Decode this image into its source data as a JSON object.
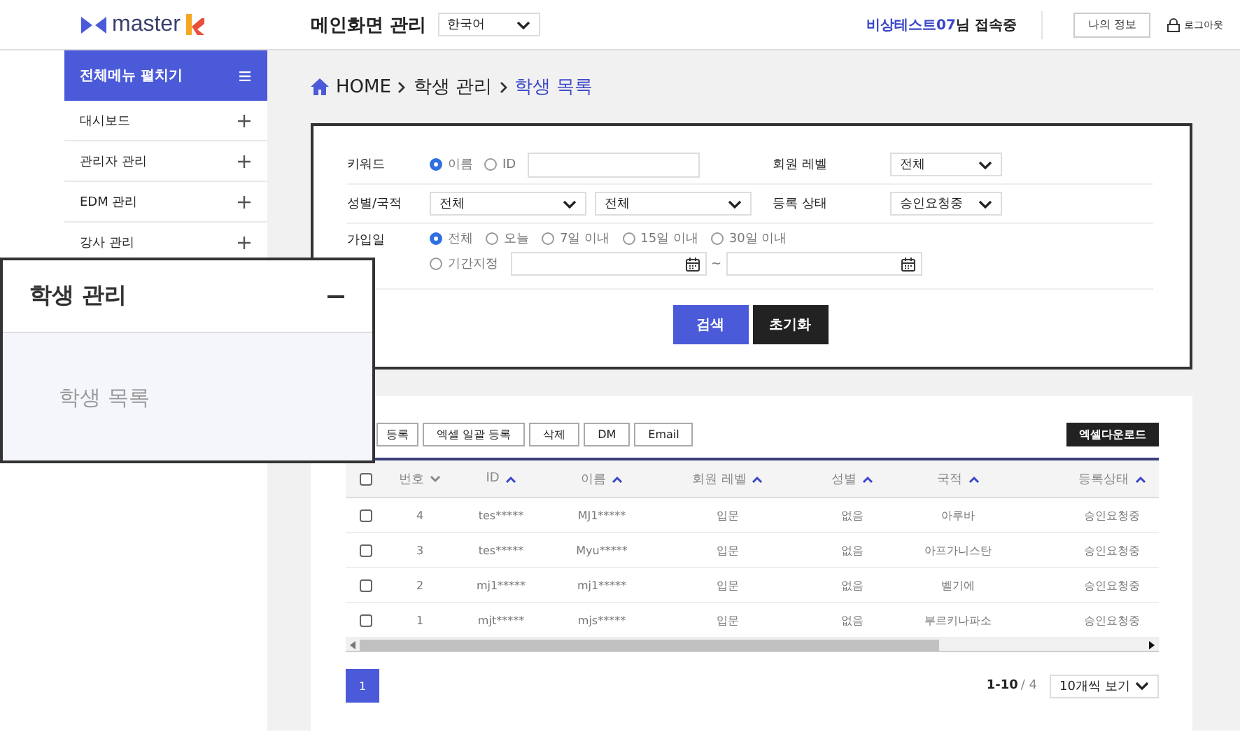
{
  "header": {
    "logo": "master",
    "title": "메인화면 관리",
    "language": "한국어",
    "user_name": "비상테스트07",
    "user_suffix": "님 접속중",
    "my_info_button": "나의 정보",
    "logout": "로그아웃"
  },
  "sidebar": {
    "toggle": "전체메뉴 펼치기",
    "items": [
      {
        "label": "대시보드",
        "expanded": false
      },
      {
        "label": "관리자 관리",
        "expanded": false
      },
      {
        "label": "EDM 관리",
        "expanded": false
      },
      {
        "label": "강사 관리",
        "expanded": false
      }
    ]
  },
  "zoom_callout": {
    "label": "학생 관리",
    "expanded": true,
    "children": [
      {
        "label": "학생 목록",
        "selected": false
      }
    ]
  },
  "breadcrumb": [
    "HOME",
    "학생 관리",
    "학생 목록"
  ],
  "search": {
    "rows": [
      {
        "kind": "keyword",
        "label": "키워드",
        "options": [
          {
            "label": "이름",
            "selected": true
          },
          {
            "label": "ID",
            "selected": false
          }
        ],
        "right_label": "회원 레벨",
        "right_select": "전체"
      },
      {
        "kind": "selects",
        "label": "성별/국적",
        "selects": [
          "전체",
          "전체"
        ],
        "right_label": "등록 상태",
        "right_select": "승인요청중"
      },
      {
        "kind": "dates",
        "label": "가입일",
        "options": [
          {
            "label": "전체",
            "selected": true
          },
          {
            "label": "오늘",
            "selected": false
          },
          {
            "label": "7일 이내",
            "selected": false
          },
          {
            "label": "15일 이내",
            "selected": false
          },
          {
            "label": "30일 이내",
            "selected": false
          }
        ],
        "range_option": {
          "label": "기간지정",
          "selected": false
        },
        "range_separator": "~"
      }
    ],
    "search_button": "검색",
    "reset_button": "초기화"
  },
  "actions": [
    "등록",
    "엑셀 일괄 등록",
    "삭제",
    "DM",
    "Email"
  ],
  "excel_download": "엑셀다운로드",
  "table": {
    "columns": [
      {
        "label": "번호",
        "ascending": false
      },
      {
        "label": "ID",
        "ascending": true
      },
      {
        "label": "이름",
        "ascending": true
      },
      {
        "label": "회원 레벨",
        "ascending": true
      },
      {
        "label": "성별",
        "ascending": true
      },
      {
        "label": "국적",
        "ascending": true
      },
      {
        "label": "등록상태",
        "ascending": true
      }
    ],
    "header_checked": false,
    "rows": [
      {
        "checked": false,
        "cells": [
          "4",
          "tes*****",
          "MJ1*****",
          "입문",
          "없음",
          "아루바",
          "승인요청중"
        ]
      },
      {
        "checked": false,
        "cells": [
          "3",
          "tes*****",
          "Myu*****",
          "입문",
          "없음",
          "아프가니스탄",
          "승인요청중"
        ]
      },
      {
        "checked": false,
        "cells": [
          "2",
          "mj1*****",
          "mj1*****",
          "입문",
          "없음",
          "벨기에",
          "승인요청중"
        ]
      },
      {
        "checked": false,
        "cells": [
          "1",
          "mjt*****",
          "mjs*****",
          "입문",
          "없음",
          "부르키나파소",
          "승인요청중"
        ]
      }
    ]
  },
  "pagination": {
    "pages": [
      {
        "label": "1",
        "selected": true
      }
    ],
    "range": "1-10",
    "total": "/ 4",
    "page_size": "10개씩 보기"
  }
}
